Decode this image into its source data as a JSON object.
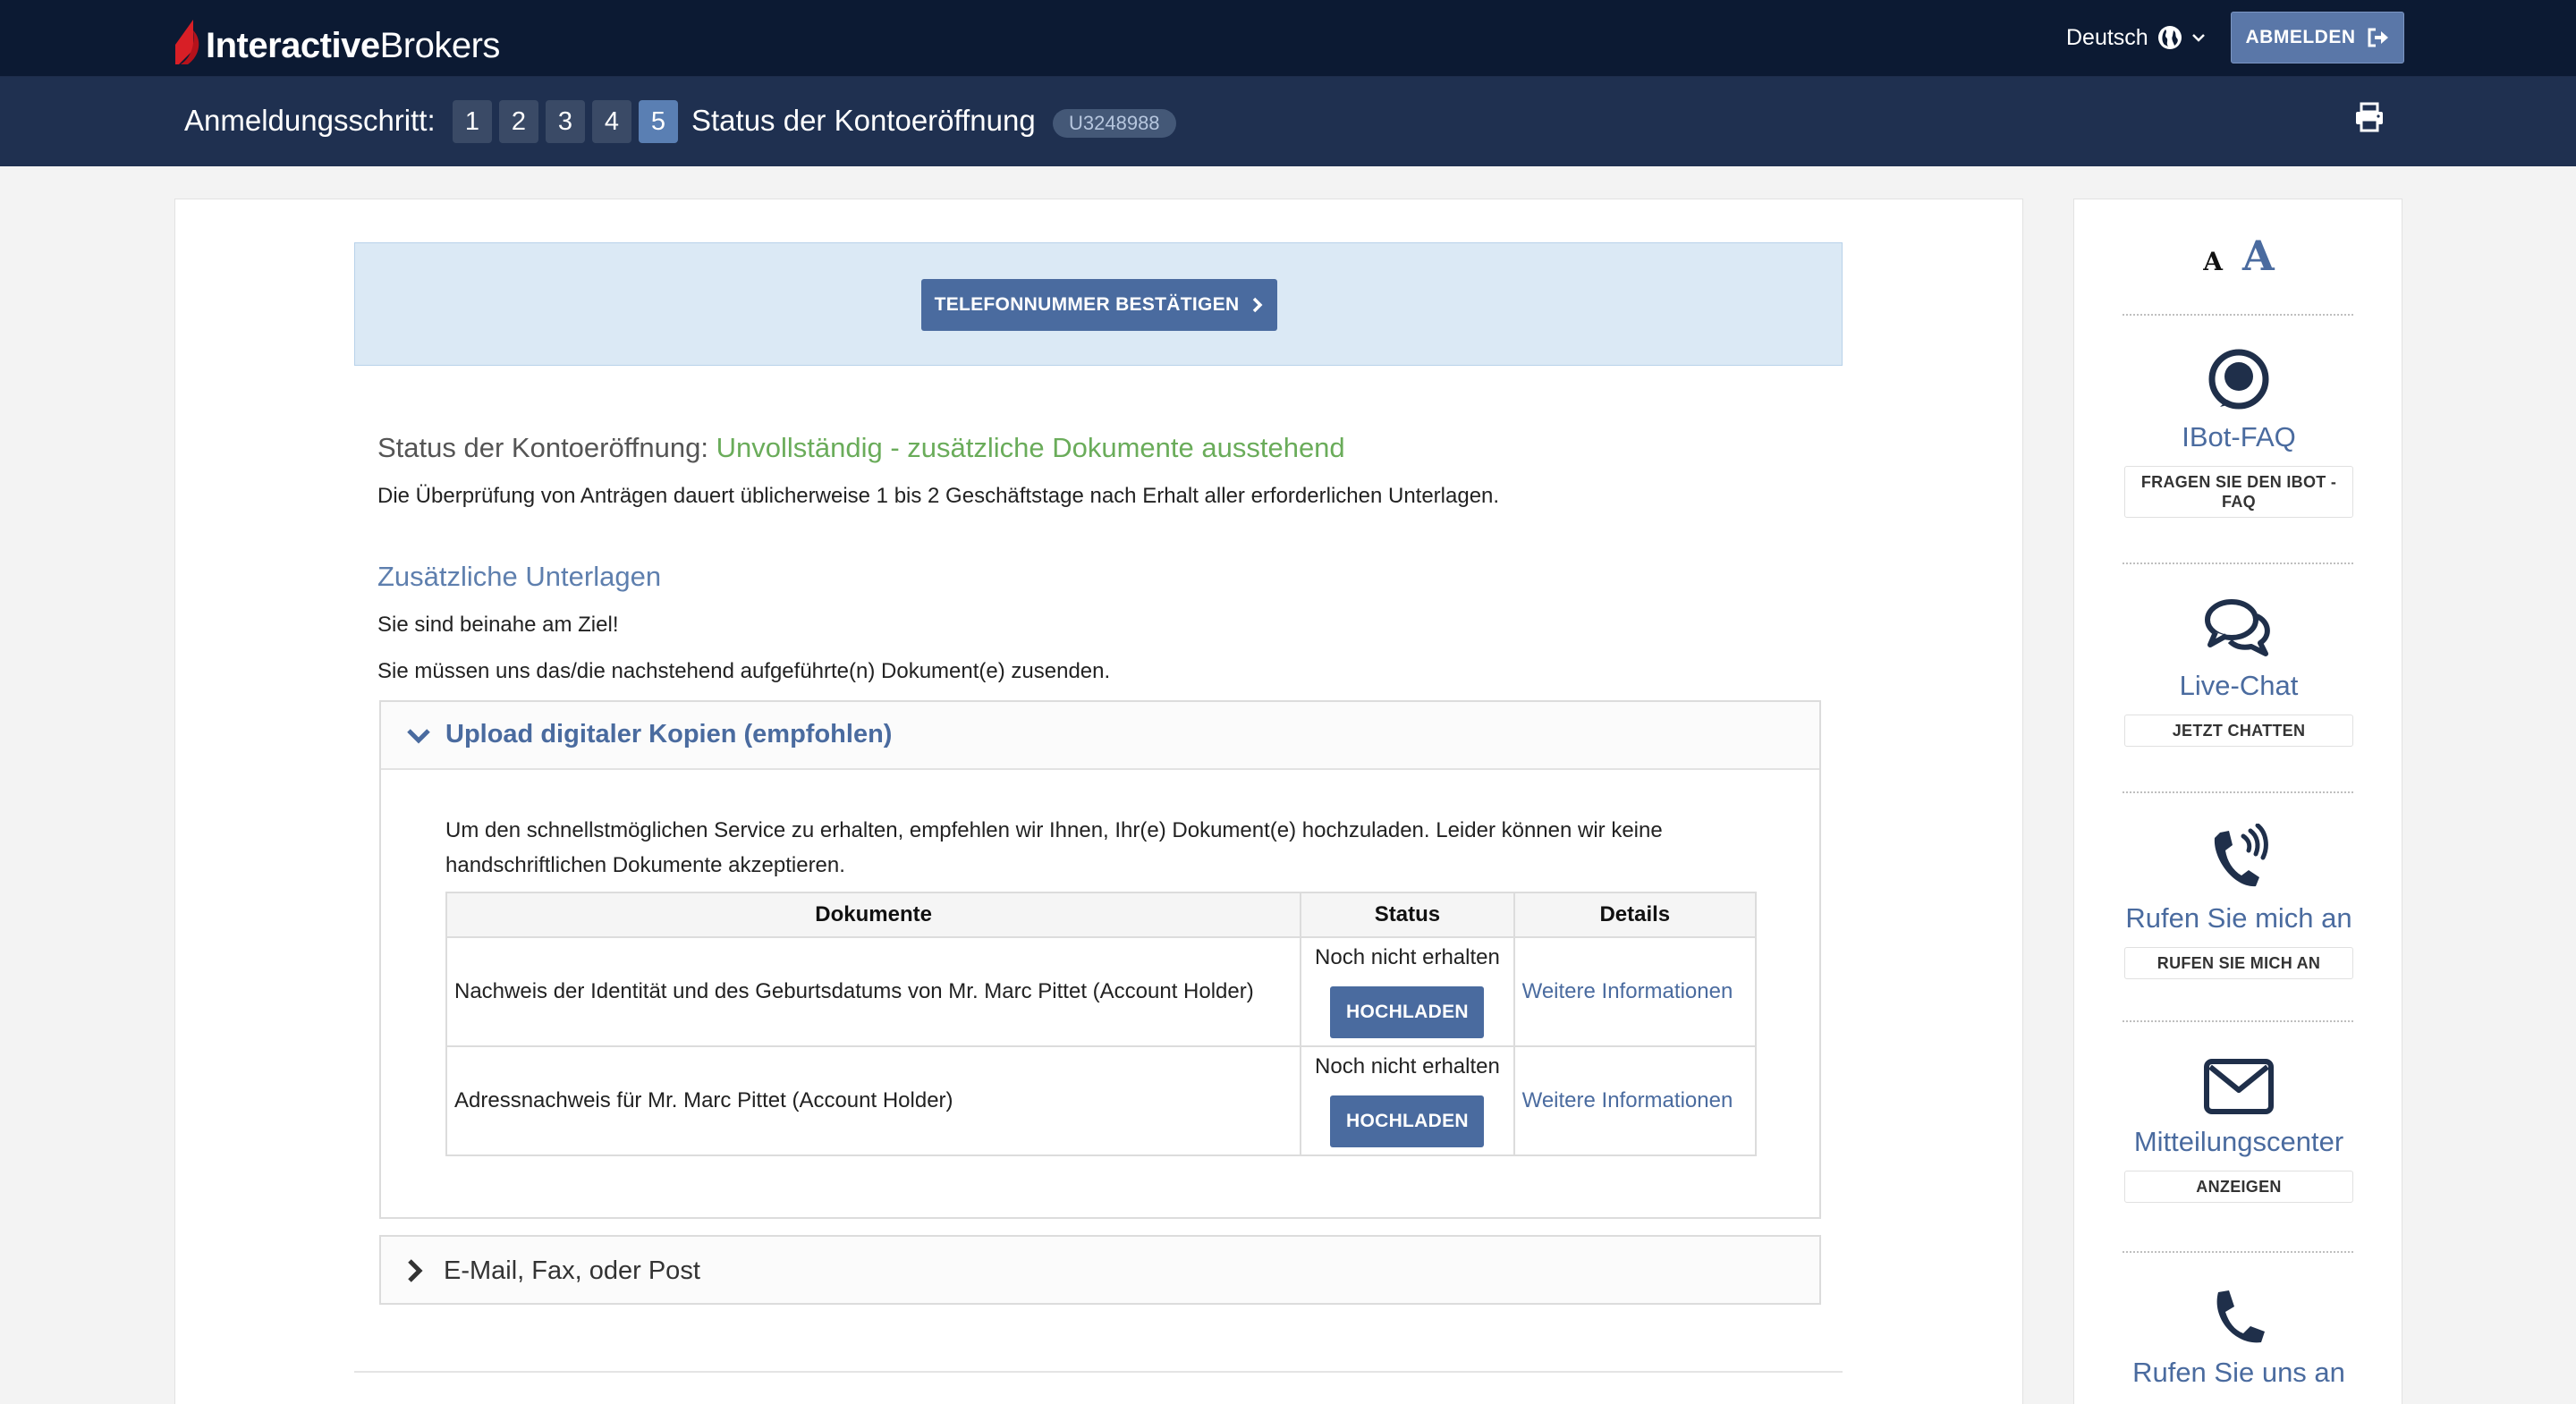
{
  "header": {
    "logo_strong": "Interactive",
    "logo_light": "Brokers",
    "language": "Deutsch",
    "logout_label": "ABMELDEN"
  },
  "stepbar": {
    "label": "Anmeldungsschritt:",
    "steps": [
      "1",
      "2",
      "3",
      "4",
      "5"
    ],
    "active_step": "5",
    "title": "Status der Kontoeröffnung",
    "account_id": "U3248988"
  },
  "alert": {
    "button_label": "TELEFONNUMMER BESTÄTIGEN"
  },
  "status": {
    "label": "Status der Kontoeröffnung:",
    "value": "Unvollständig - zusätzliche Dokumente ausstehend",
    "description": "Die Überprüfung von Anträgen dauert üblicherweise 1 bis 2 Geschäftstage nach Erhalt aller erforderlichen Unterlagen."
  },
  "documents": {
    "heading": "Zusätzliche Unterlagen",
    "almost_there": "Sie sind beinahe am Ziel!",
    "must_send": "Sie müssen uns das/die nachstehend aufgeführte(n) Dokument(e) zusenden.",
    "upload_section": {
      "title": "Upload digitaler Kopien (empfohlen)",
      "intro": "Um den schnellstmöglichen Service zu erhalten, empfehlen wir Ihnen, Ihr(e) Dokument(e) hochzuladen. Leider können wir keine handschriftlichen Dokumente akzeptieren.",
      "columns": [
        "Dokumente",
        "Status",
        "Details"
      ],
      "rows": [
        {
          "document": "Nachweis der Identität und des Geburtsdatums von Mr. Marc Pittet (Account Holder)",
          "status": "Noch nicht erhalten",
          "button": "HOCHLADEN",
          "details": "Weitere Informationen"
        },
        {
          "document": "Adressnachweis für Mr. Marc Pittet (Account Holder)",
          "status": "Noch nicht erhalten",
          "button": "HOCHLADEN",
          "details": "Weitere Informationen"
        }
      ]
    },
    "mail_section": {
      "title": "E-Mail, Fax, oder Post"
    }
  },
  "sidebar": {
    "font_small": "A",
    "font_large": "A",
    "items": [
      {
        "icon": "ibot-icon",
        "title": "IBot-FAQ",
        "button": "FRAGEN SIE DEN IBOT - FAQ"
      },
      {
        "icon": "chat-bubbles-icon",
        "title": "Live-Chat",
        "button": "JETZT CHATTEN"
      },
      {
        "icon": "phone-ringing-icon",
        "title": "Rufen Sie mich an",
        "button": "RUFEN SIE MICH AN"
      },
      {
        "icon": "envelope-icon",
        "title": "Mitteilungscenter",
        "button": "ANZEIGEN"
      },
      {
        "icon": "phone-icon",
        "title": "Rufen Sie uns an"
      }
    ]
  },
  "colors": {
    "navbar": "#0c1a33",
    "stepbar": "#1f3050",
    "accent": "#4a6b9f",
    "status_green": "#6aac5a",
    "alert_bg": "#dbe9f5"
  }
}
